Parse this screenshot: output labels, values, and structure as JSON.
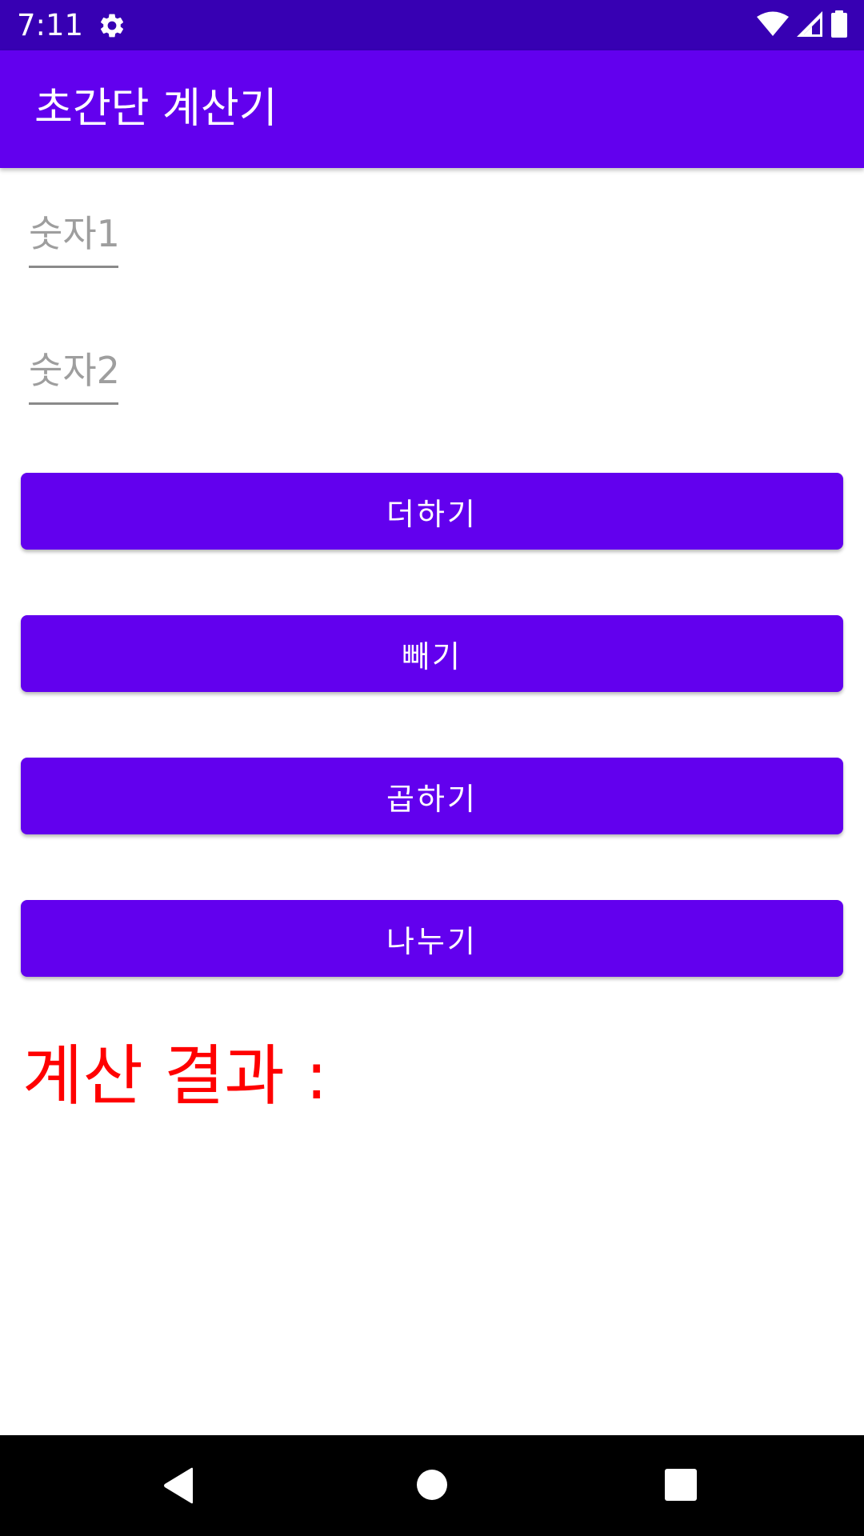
{
  "status_bar": {
    "time": "7:11",
    "icons": [
      "settings-icon",
      "wifi-icon",
      "signal-icon",
      "battery-icon"
    ]
  },
  "app_bar": {
    "title": "초간단 계산기"
  },
  "inputs": {
    "number1": {
      "value": "",
      "placeholder": "숫자1"
    },
    "number2": {
      "value": "",
      "placeholder": "숫자2"
    }
  },
  "buttons": {
    "add": "더하기",
    "subtract": "빼기",
    "multiply": "곱하기",
    "divide": "나누기"
  },
  "result": {
    "label": "계산 결과 :"
  },
  "nav_bar": {
    "icons": [
      "back-icon",
      "home-icon",
      "recents-icon"
    ]
  },
  "colors": {
    "status_bar": "#3700b3",
    "primary": "#6200ee",
    "result_text": "#ff0000",
    "nav_bar": "#000000"
  }
}
